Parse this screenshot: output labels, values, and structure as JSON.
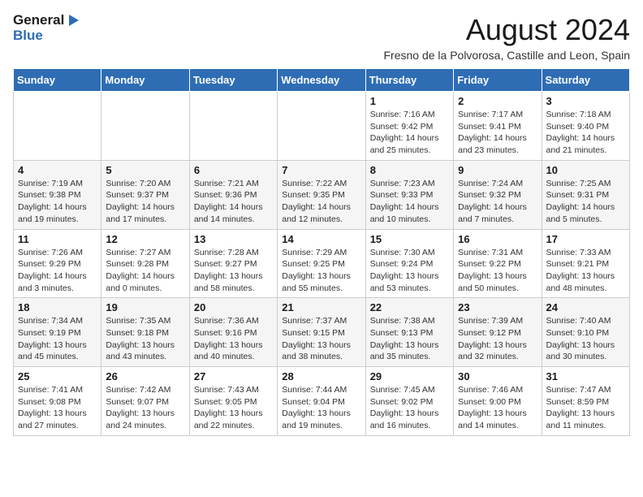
{
  "logo": {
    "line1": "General",
    "line2": "Blue"
  },
  "title": {
    "month_year": "August 2024",
    "location": "Fresno de la Polvorosa, Castille and Leon, Spain"
  },
  "days_of_week": [
    "Sunday",
    "Monday",
    "Tuesday",
    "Wednesday",
    "Thursday",
    "Friday",
    "Saturday"
  ],
  "weeks": [
    [
      {
        "num": "",
        "info": ""
      },
      {
        "num": "",
        "info": ""
      },
      {
        "num": "",
        "info": ""
      },
      {
        "num": "",
        "info": ""
      },
      {
        "num": "1",
        "info": "Sunrise: 7:16 AM\nSunset: 9:42 PM\nDaylight: 14 hours and 25 minutes."
      },
      {
        "num": "2",
        "info": "Sunrise: 7:17 AM\nSunset: 9:41 PM\nDaylight: 14 hours and 23 minutes."
      },
      {
        "num": "3",
        "info": "Sunrise: 7:18 AM\nSunset: 9:40 PM\nDaylight: 14 hours and 21 minutes."
      }
    ],
    [
      {
        "num": "4",
        "info": "Sunrise: 7:19 AM\nSunset: 9:38 PM\nDaylight: 14 hours and 19 minutes."
      },
      {
        "num": "5",
        "info": "Sunrise: 7:20 AM\nSunset: 9:37 PM\nDaylight: 14 hours and 17 minutes."
      },
      {
        "num": "6",
        "info": "Sunrise: 7:21 AM\nSunset: 9:36 PM\nDaylight: 14 hours and 14 minutes."
      },
      {
        "num": "7",
        "info": "Sunrise: 7:22 AM\nSunset: 9:35 PM\nDaylight: 14 hours and 12 minutes."
      },
      {
        "num": "8",
        "info": "Sunrise: 7:23 AM\nSunset: 9:33 PM\nDaylight: 14 hours and 10 minutes."
      },
      {
        "num": "9",
        "info": "Sunrise: 7:24 AM\nSunset: 9:32 PM\nDaylight: 14 hours and 7 minutes."
      },
      {
        "num": "10",
        "info": "Sunrise: 7:25 AM\nSunset: 9:31 PM\nDaylight: 14 hours and 5 minutes."
      }
    ],
    [
      {
        "num": "11",
        "info": "Sunrise: 7:26 AM\nSunset: 9:29 PM\nDaylight: 14 hours and 3 minutes."
      },
      {
        "num": "12",
        "info": "Sunrise: 7:27 AM\nSunset: 9:28 PM\nDaylight: 14 hours and 0 minutes."
      },
      {
        "num": "13",
        "info": "Sunrise: 7:28 AM\nSunset: 9:27 PM\nDaylight: 13 hours and 58 minutes."
      },
      {
        "num": "14",
        "info": "Sunrise: 7:29 AM\nSunset: 9:25 PM\nDaylight: 13 hours and 55 minutes."
      },
      {
        "num": "15",
        "info": "Sunrise: 7:30 AM\nSunset: 9:24 PM\nDaylight: 13 hours and 53 minutes."
      },
      {
        "num": "16",
        "info": "Sunrise: 7:31 AM\nSunset: 9:22 PM\nDaylight: 13 hours and 50 minutes."
      },
      {
        "num": "17",
        "info": "Sunrise: 7:33 AM\nSunset: 9:21 PM\nDaylight: 13 hours and 48 minutes."
      }
    ],
    [
      {
        "num": "18",
        "info": "Sunrise: 7:34 AM\nSunset: 9:19 PM\nDaylight: 13 hours and 45 minutes."
      },
      {
        "num": "19",
        "info": "Sunrise: 7:35 AM\nSunset: 9:18 PM\nDaylight: 13 hours and 43 minutes."
      },
      {
        "num": "20",
        "info": "Sunrise: 7:36 AM\nSunset: 9:16 PM\nDaylight: 13 hours and 40 minutes."
      },
      {
        "num": "21",
        "info": "Sunrise: 7:37 AM\nSunset: 9:15 PM\nDaylight: 13 hours and 38 minutes."
      },
      {
        "num": "22",
        "info": "Sunrise: 7:38 AM\nSunset: 9:13 PM\nDaylight: 13 hours and 35 minutes."
      },
      {
        "num": "23",
        "info": "Sunrise: 7:39 AM\nSunset: 9:12 PM\nDaylight: 13 hours and 32 minutes."
      },
      {
        "num": "24",
        "info": "Sunrise: 7:40 AM\nSunset: 9:10 PM\nDaylight: 13 hours and 30 minutes."
      }
    ],
    [
      {
        "num": "25",
        "info": "Sunrise: 7:41 AM\nSunset: 9:08 PM\nDaylight: 13 hours and 27 minutes."
      },
      {
        "num": "26",
        "info": "Sunrise: 7:42 AM\nSunset: 9:07 PM\nDaylight: 13 hours and 24 minutes."
      },
      {
        "num": "27",
        "info": "Sunrise: 7:43 AM\nSunset: 9:05 PM\nDaylight: 13 hours and 22 minutes."
      },
      {
        "num": "28",
        "info": "Sunrise: 7:44 AM\nSunset: 9:04 PM\nDaylight: 13 hours and 19 minutes."
      },
      {
        "num": "29",
        "info": "Sunrise: 7:45 AM\nSunset: 9:02 PM\nDaylight: 13 hours and 16 minutes."
      },
      {
        "num": "30",
        "info": "Sunrise: 7:46 AM\nSunset: 9:00 PM\nDaylight: 13 hours and 14 minutes."
      },
      {
        "num": "31",
        "info": "Sunrise: 7:47 AM\nSunset: 8:59 PM\nDaylight: 13 hours and 11 minutes."
      }
    ]
  ]
}
